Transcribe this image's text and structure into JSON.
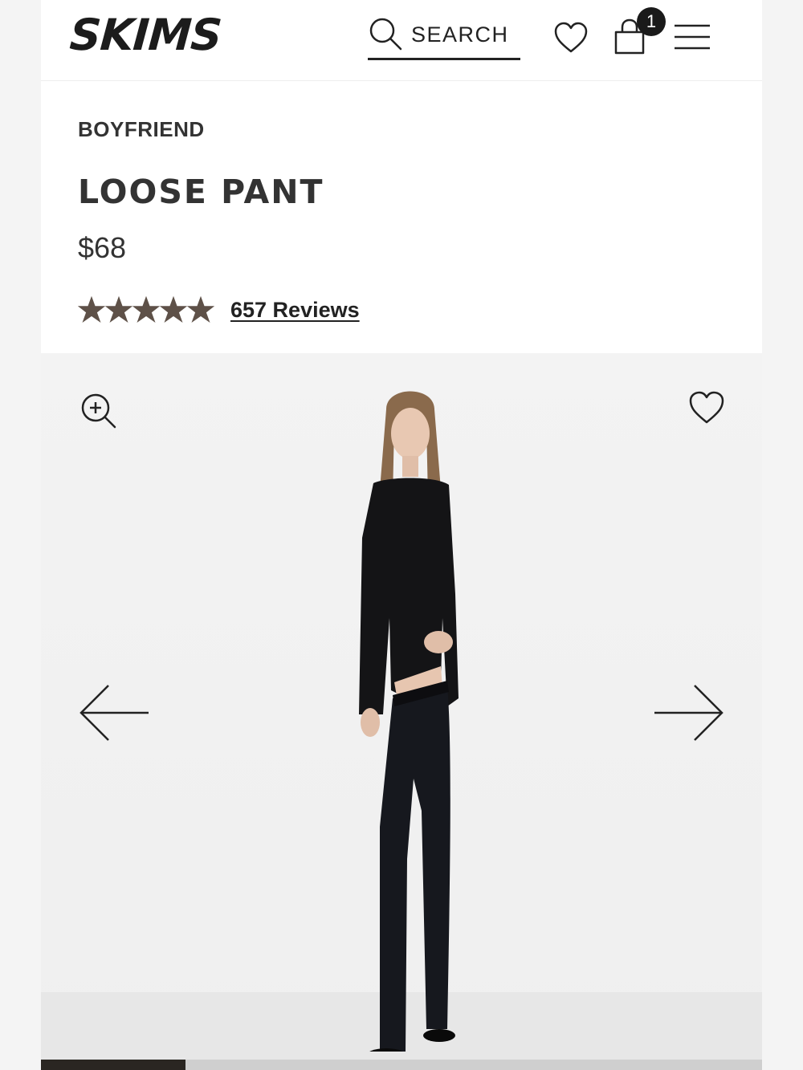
{
  "header": {
    "logo_text": "SKIMS",
    "search_label": "SEARCH",
    "cart_count": "1",
    "icons": [
      "search-icon",
      "heart-icon",
      "shopping-bag-icon",
      "hamburger-menu-icon"
    ]
  },
  "product": {
    "collection": "BOYFRIEND",
    "title": "LOOSE PANT",
    "price": "$68",
    "rating": 5,
    "rating_max": 5,
    "reviews_label": "657 Reviews"
  },
  "gallery": {
    "icons": [
      "zoom-in-icon",
      "heart-icon",
      "arrow-left-icon",
      "arrow-right-icon"
    ],
    "progress_fraction": 0.2
  },
  "colors": {
    "star": "#5e5148",
    "text": "#333333",
    "badge": "#1a1a1a",
    "progress": "#2a2622"
  }
}
